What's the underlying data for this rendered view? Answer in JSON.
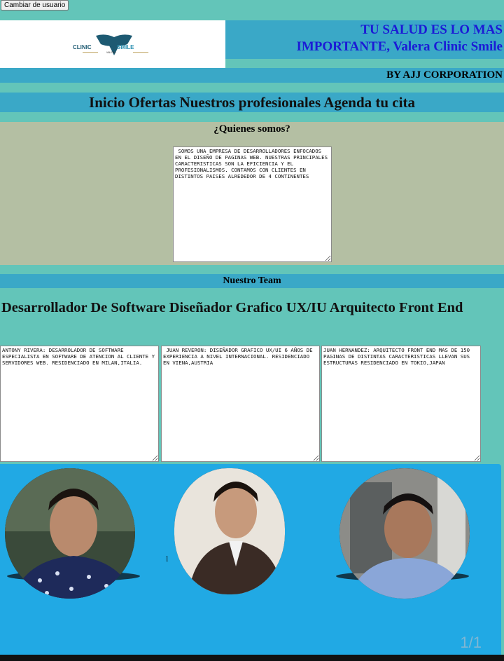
{
  "topbar": {
    "switch_user_label": "Cambiar de usuario"
  },
  "header": {
    "logo": {
      "brand_word_1": "CLINIC",
      "brand_word_2": "SMILE",
      "sub": "VALERA"
    },
    "slogan_line1": "TU SALUD ES LO MAS",
    "slogan_line2": "IMPORTANTE, Valera Clinic Smile",
    "by_line": "BY AJJ CORPORATION"
  },
  "nav": {
    "items": [
      {
        "label": "Inicio"
      },
      {
        "label": "Ofertas"
      },
      {
        "label": "Nuestros profesionales"
      },
      {
        "label": "Agenda tu cita"
      }
    ]
  },
  "about": {
    "title": "¿Quienes somos?",
    "text": " SOMOS UNA EMPRESA DE DESARROLLADORES ENFOCADOS EN EL DISEÑO DE PAGINAS WEB. NUESTRAS PRINCIPALES CARACTERISTICAS SON LA EFICIENCIA Y EL PROFESIONALISMOS. CONTAMOS CON CLIENTES EN DISTINTOS PAISES ALREDEDOR DE 4 CONTINENTES"
  },
  "team": {
    "title": "Nuestro Team",
    "roles_heading": "Desarrollador De Software Diseñador Grafico UX/IU Arquitecto Front End",
    "members": [
      {
        "bio": "ANTONY RIVERA: DESARROLADOR DE SOFTWARE ESPECIALISTA EN SOFTWARE DE ATENCION AL CLIENTE Y SERVIDORES WEB. RESIDENCIADO EN MILAN,ITALIA."
      },
      {
        "bio": " JUAN REVERON: DISEÑADOR GRAFICO UX/UI 6 AÑOS DE EXPERIENCIA A NIVEL INTERNACIONAL. RESIDENCIADO EN VIENA,AUSTRIA"
      },
      {
        "bio": "JUAN HERNANDEZ: ARQUITECTO FRONT END MAS DE 150 PAGINAS DE DISTINTAS CARACTERISTICAS LLEVAN SUS ESTRUCTURAS RESIDENCIADO EN TOKIO,JAPAN"
      }
    ]
  },
  "gallery": {
    "stray_char": "l",
    "counter": "1/1"
  },
  "colors": {
    "page_bg": "#63c5b9",
    "band": "#3aa8c7",
    "slogan": "#1b1bd6",
    "about_bg": "#b4bfa3",
    "gallery_bg": "#21a9e4"
  }
}
